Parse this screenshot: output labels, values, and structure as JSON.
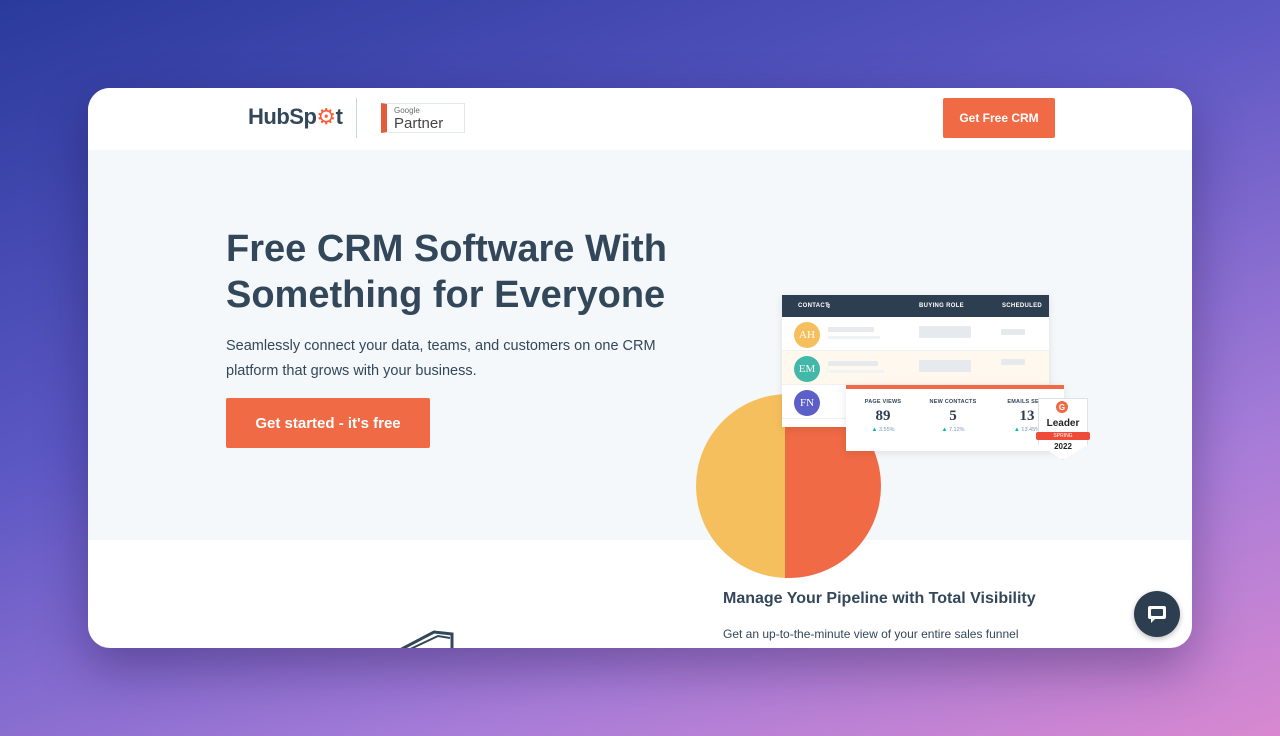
{
  "nav": {
    "logo_text_a": "HubSp",
    "logo_text_b": "t",
    "partner_small": "Google",
    "partner_big": "Partner",
    "cta_label": "Get Free CRM"
  },
  "hero": {
    "title": "Free CRM Software With Something for Everyone",
    "subtitle": "Seamlessly connect your data, teams, and customers on one CRM platform that grows with your business.",
    "cta_label": "Get started - it's free"
  },
  "crm_table": {
    "headers": [
      "CONTACT",
      "BUYING ROLE",
      "SCHEDULED"
    ],
    "rows": [
      {
        "initials": "AH",
        "color": "#f5bf5e"
      },
      {
        "initials": "EM",
        "color": "#41b8a8"
      },
      {
        "initials": "FN",
        "color": "#5b5fc7"
      }
    ]
  },
  "stats": [
    {
      "label": "PAGE VIEWS",
      "value": "89",
      "delta": "3.55%"
    },
    {
      "label": "NEW CONTACTS",
      "value": "5",
      "delta": "7.12%"
    },
    {
      "label": "EMAILS SENT",
      "value": "13",
      "delta": "13.45%"
    }
  ],
  "badge": {
    "logo": "G",
    "title": "Leader",
    "season": "SPRING",
    "year": "2022"
  },
  "section2": {
    "title": "Manage Your Pipeline with Total Visibility",
    "text": "Get an up-to-the-minute view of your entire sales funnel"
  },
  "colors": {
    "accent": "#ef6a45",
    "dark": "#33475b",
    "hero_bg": "#f5f8fa"
  },
  "icons": {
    "chat": "chat-bubble-icon"
  }
}
